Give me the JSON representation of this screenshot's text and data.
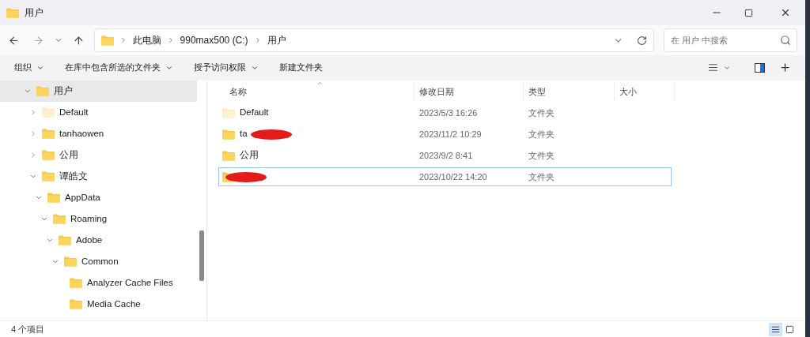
{
  "window": {
    "title": "用户"
  },
  "address_bar": {
    "breadcrumbs": [
      "此电脑",
      "990max500 (C:)",
      "用户"
    ]
  },
  "search": {
    "placeholder": "在 用户 中搜索"
  },
  "command_bar": {
    "items": [
      "组织",
      "在库中包含所选的文件夹",
      "授予访问权限",
      "新建文件夹"
    ],
    "dropdowns": [
      true,
      true,
      true,
      false
    ]
  },
  "sidebar": {
    "items": [
      {
        "label": "用户",
        "expanded": true,
        "selected": true,
        "hidden": false,
        "children": [
          {
            "label": "Default",
            "expanded": false,
            "selected": false,
            "hidden": true
          },
          {
            "label": "tanhaowen",
            "expanded": false,
            "selected": false,
            "hidden": false
          },
          {
            "label": "公用",
            "expanded": false,
            "selected": false,
            "hidden": false
          },
          {
            "label": "谭皓文",
            "expanded": true,
            "selected": false,
            "hidden": false,
            "children": [
              {
                "label": "AppData",
                "expanded": true,
                "selected": false,
                "hidden": false,
                "children": [
                  {
                    "label": "Roaming",
                    "expanded": true,
                    "selected": false,
                    "hidden": false,
                    "children": [
                      {
                        "label": "Adobe",
                        "expanded": true,
                        "selected": false,
                        "hidden": false,
                        "children": [
                          {
                            "label": "Common",
                            "expanded": true,
                            "selected": false,
                            "hidden": false,
                            "children": [
                              {
                                "label": "Analyzer Cache Files",
                                "selected": false,
                                "hidden": false
                              },
                              {
                                "label": "Media Cache",
                                "selected": false,
                                "hidden": false
                              }
                            ]
                          }
                        ]
                      }
                    ]
                  }
                ]
              }
            ]
          }
        ]
      }
    ]
  },
  "table": {
    "columns": [
      "名称",
      "修改日期",
      "类型",
      "大小"
    ],
    "rows": [
      {
        "name": "Default",
        "date": "2023/5/3 16:26",
        "type": "文件夹",
        "selected": false,
        "hidden": true,
        "redacted": false
      },
      {
        "name": "ta",
        "date": "2023/11/2 10:29",
        "type": "文件夹",
        "selected": false,
        "hidden": false,
        "redacted": true
      },
      {
        "name": "公用",
        "date": "2023/9/2 8:41",
        "type": "文件夹",
        "selected": false,
        "hidden": false,
        "redacted": false
      },
      {
        "name": "",
        "date": "2023/10/22 14:20",
        "type": "文件夹",
        "selected": true,
        "hidden": false,
        "redacted": true
      }
    ]
  },
  "status_bar": {
    "text": "4 个项目"
  }
}
